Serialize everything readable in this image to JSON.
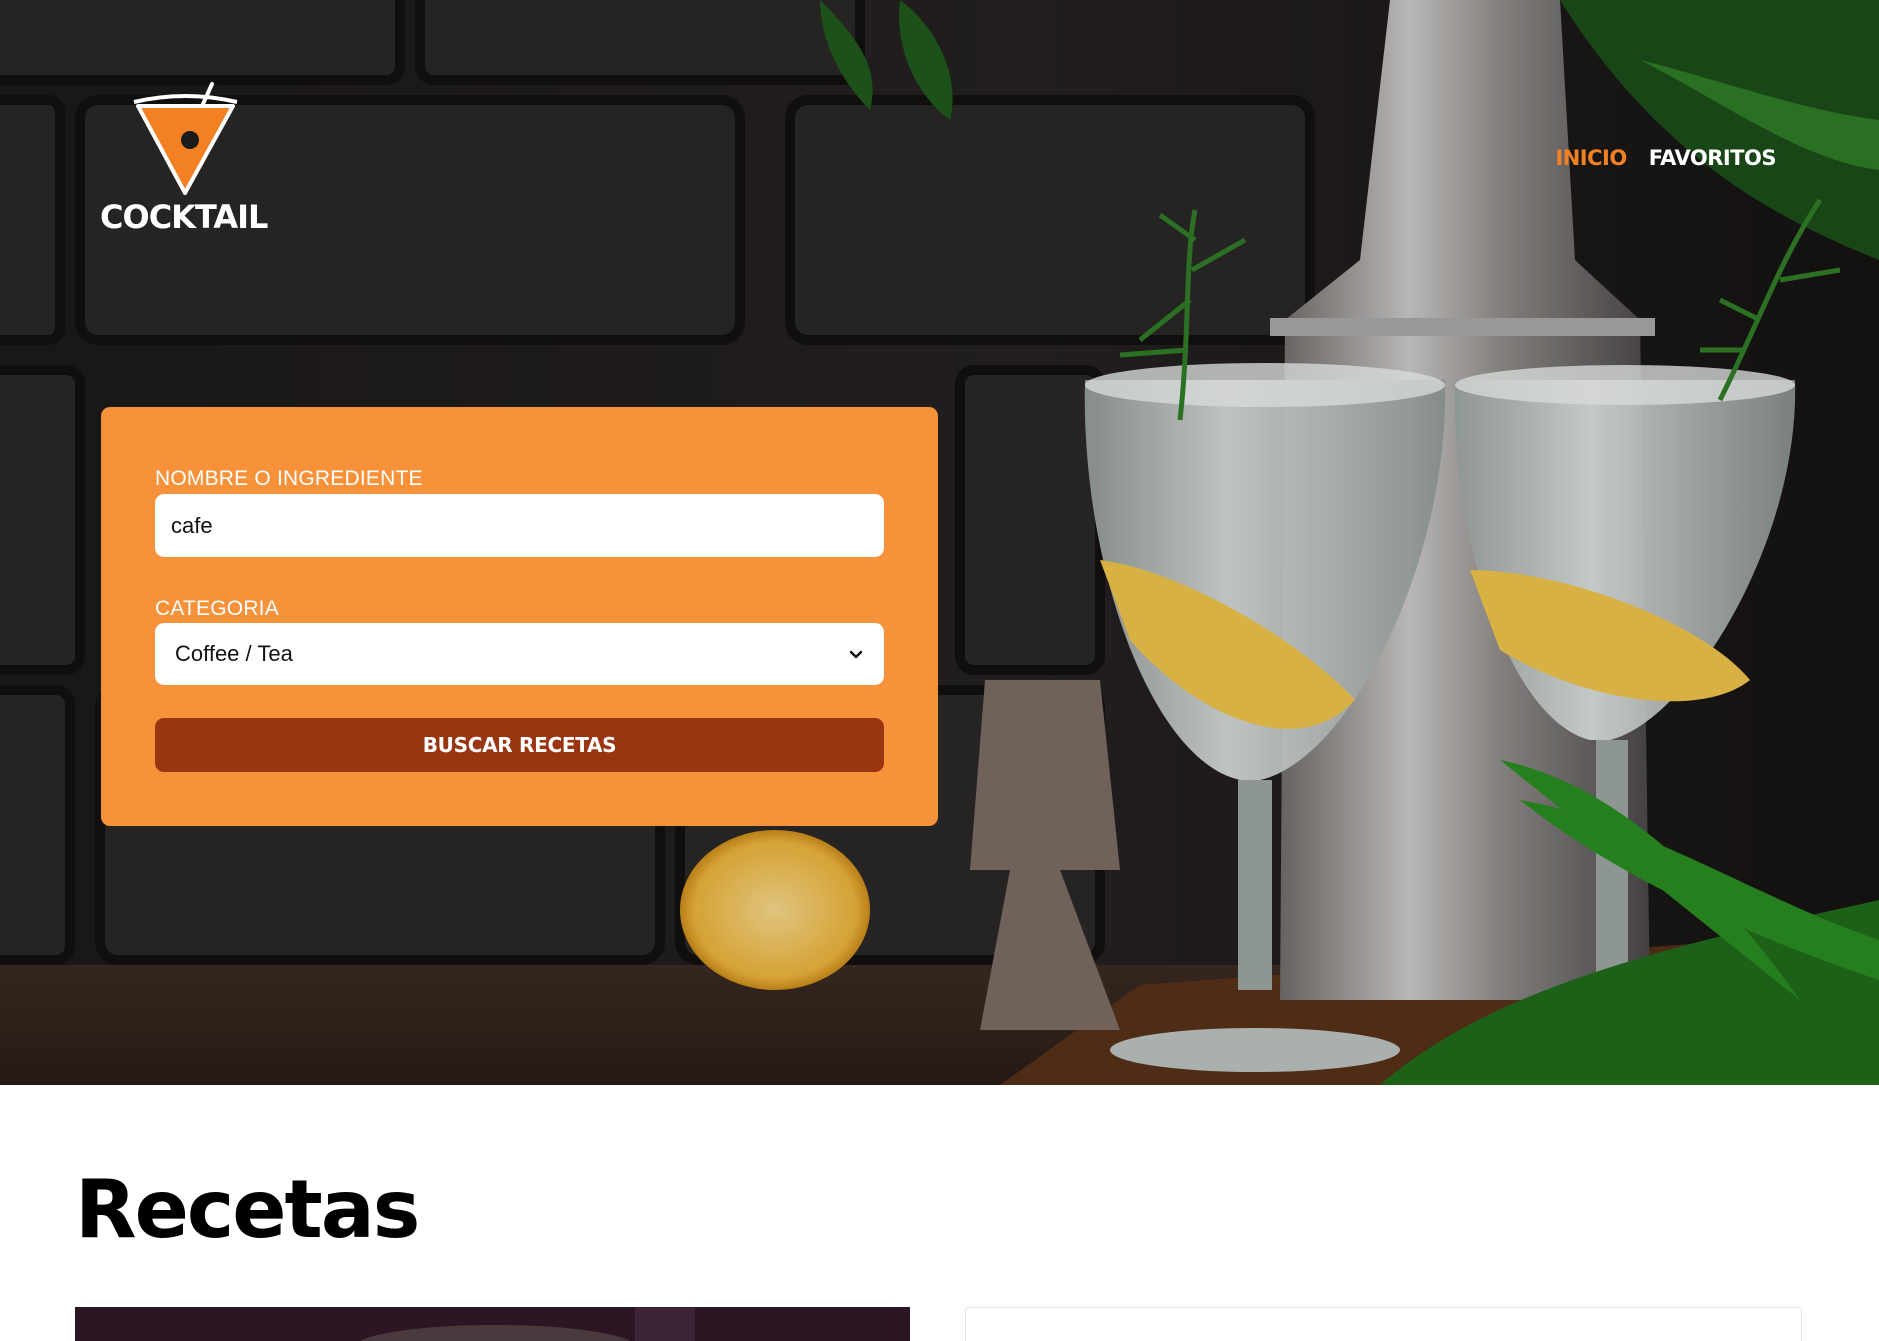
{
  "brand": {
    "name": "COCKTAIL",
    "logo_icon": "martini-glass-icon",
    "accent": "#f48024"
  },
  "nav": {
    "items": [
      {
        "label": "INICIO",
        "active": true
      },
      {
        "label": "FAVORITOS",
        "active": false
      }
    ]
  },
  "search_form": {
    "name_label": "NOMBRE O INGREDIENTE",
    "name_value": "cafe",
    "category_label": "CATEGORIA",
    "category_value": "Coffee / Tea",
    "submit_label": "BUSCAR RECETAS",
    "card_color": "#f7913a",
    "button_color": "#9a3512"
  },
  "recipes": {
    "title": "Recetas"
  }
}
